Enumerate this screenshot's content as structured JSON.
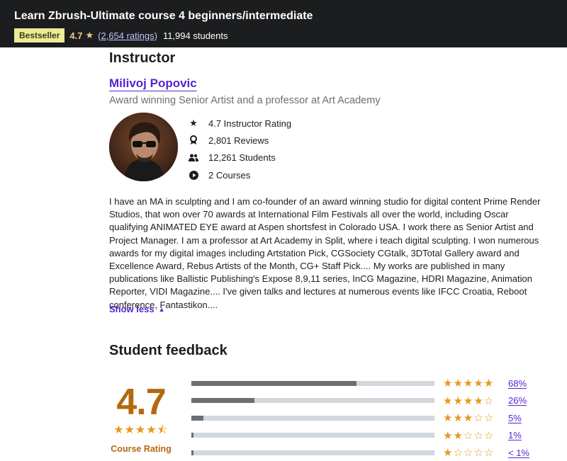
{
  "header": {
    "title": "Learn Zbrush-Ultimate course 4 beginners/intermediate",
    "badge": "Bestseller",
    "rating": "4.7",
    "ratings_count": "(2,654 ratings)",
    "students": "11,994 students"
  },
  "instructor": {
    "heading": "Instructor",
    "name": "Milivoj Popovic",
    "subtitle": "Award winning Senior Artist and a professor at Art Academy",
    "stats": [
      {
        "icon": "star-icon",
        "text": "4.7 Instructor Rating"
      },
      {
        "icon": "award-icon",
        "text": "2,801 Reviews"
      },
      {
        "icon": "students-icon",
        "text": "12,261 Students"
      },
      {
        "icon": "play-icon",
        "text": "2 Courses"
      }
    ],
    "bio": "I have an MA in sculpting and I am co-founder of an award winning studio for digital content Prime Render Studios, that won over 70 awards at International Film Festivals all over the world, including Oscar qualifying ANIMATED EYE award at Aspen shortsfest in Colorado USA. I work there as Senior Artist and Project Manager. I am a professor at Art Academy in Split, where i teach digital sculpting. I won numerous awards for my digital images including Artstation Pick, CGSociety CGtalk, 3DTotal Gallery award and Excellence Award, Rebus Artists of the Month, CG+ Staff Pick.... My works are published in many publications like Ballistic Publishing's Expose 8,9,11 series, InCG Magazine, HDRI Magazine, Animation Reporter, VIDI Magazine.... I've given talks and lectures at numerous events like IFCC Croatia, Reboot conference, Fantastikon....",
    "show_less": "Show less"
  },
  "feedback": {
    "heading": "Student feedback",
    "rating": "4.7",
    "stars": "★★★★⯪",
    "label": "Course Rating",
    "rows": [
      {
        "stars": "★★★★★",
        "pct": "68%",
        "fill": 0.68
      },
      {
        "stars": "★★★★☆",
        "pct": "26%",
        "fill": 0.26
      },
      {
        "stars": "★★★☆☆",
        "pct": "5%",
        "fill": 0.05
      },
      {
        "stars": "★★☆☆☆",
        "pct": "1%",
        "fill": 0.01
      },
      {
        "stars": "★☆☆☆☆",
        "pct": "< 1%",
        "fill": 0.0
      }
    ]
  },
  "colors": {
    "topbar": "#1c1d1f",
    "badge": "#eceb98",
    "link": "#5624d0",
    "rating": "#b4690e",
    "star": "#e59819"
  }
}
